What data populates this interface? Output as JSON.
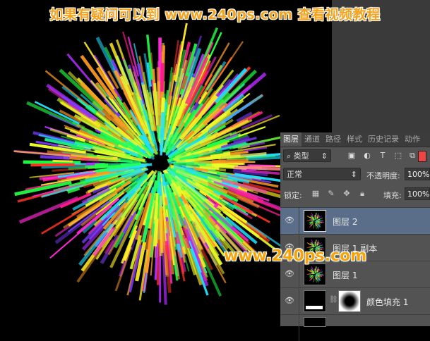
{
  "header": {
    "text": "如果有疑问可以到  www.240ps.com  查看视频教程"
  },
  "watermark": {
    "text": "www.240ps.com"
  },
  "colors": {
    "accent": "#f5a21c",
    "panel_bg": "#535353",
    "selected_layer": "#5a6e8a"
  },
  "layers_panel": {
    "tabs": [
      "图层",
      "通道",
      "路径",
      "样式",
      "历史记录",
      "动作"
    ],
    "filter": {
      "label": "类型",
      "icons": [
        "image-filter-icon",
        "adjustment-filter-icon",
        "type-filter-icon",
        "shape-filter-icon",
        "smart-object-filter-icon"
      ]
    },
    "blend_mode": "正常",
    "opacity_label": "不透明度:",
    "opacity_value": "100%",
    "lock_label": "锁定:",
    "fill_label": "填充:",
    "fill_value": "100%",
    "layers": [
      {
        "name": "图层 2",
        "selected": true
      },
      {
        "name": "图层 1 副本",
        "selected": false
      },
      {
        "name": "图层 1",
        "selected": false
      },
      {
        "name": "颜色填充 1",
        "selected": false
      }
    ]
  }
}
